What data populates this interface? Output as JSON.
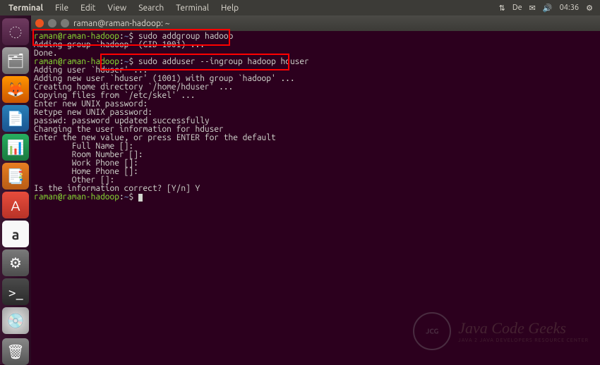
{
  "menubar": {
    "app": "Terminal",
    "items": [
      "File",
      "Edit",
      "View",
      "Search",
      "Terminal",
      "Help"
    ],
    "lang": "De",
    "time": "04:36"
  },
  "titlebar": {
    "title": "raman@raman-hadoop: ~"
  },
  "prompt": {
    "user": "raman@raman-hadoop",
    "sep": ":",
    "path": "~",
    "symbol": "$"
  },
  "cmds": {
    "c1": "sudo addgroup hadoop",
    "c2": "sudo adduser --ingroup hadoop hduser"
  },
  "out": {
    "l1": "Adding group `hadoop' (GID 1001) ...",
    "l2": "Done.",
    "l3": "Adding user `hduser' ...",
    "l4": "Adding new user `hduser' (1001) with group `hadoop' ...",
    "l5": "Creating home directory `/home/hduser' ...",
    "l6": "Copying files from `/etc/skel' ...",
    "l7": "Enter new UNIX password: ",
    "l8": "Retype new UNIX password: ",
    "l9": "passwd: password updated successfully",
    "l10": "Changing the user information for hduser",
    "l11": "Enter the new value, or press ENTER for the default",
    "l12": "        Full Name []: ",
    "l13": "        Room Number []: ",
    "l14": "        Work Phone []: ",
    "l15": "        Home Phone []: ",
    "l16": "        Other []: ",
    "l17": "Is the information correct? [Y/n] Y"
  },
  "watermark": {
    "title": "Java Code Geeks",
    "sub": "Java 2 Java Developers Resource Center",
    "badge": "JCG"
  }
}
